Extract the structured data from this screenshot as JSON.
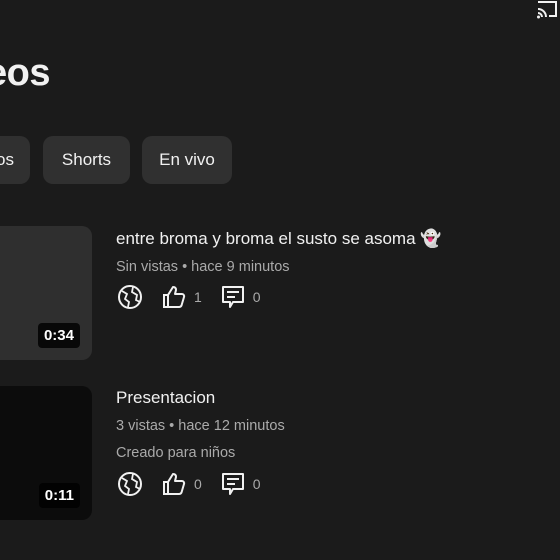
{
  "header": {
    "title": "eos",
    "cast_icon": "cast-icon"
  },
  "tabs": [
    {
      "label": "os"
    },
    {
      "label": "Shorts"
    },
    {
      "label": "En vivo"
    }
  ],
  "videos": [
    {
      "title": "entre broma y broma el susto se asoma 👻",
      "meta": "Sin vistas • hace 9 minutos",
      "made_for_kids": "",
      "duration": "0:34",
      "visibility_icon": "globe-icon",
      "likes": "1",
      "comments": "0"
    },
    {
      "title": "Presentacion",
      "meta": "3 vistas • hace 12 minutos",
      "made_for_kids": "Creado para niños",
      "duration": "0:11",
      "visibility_icon": "globe-icon",
      "likes": "0",
      "comments": "0"
    }
  ],
  "colors": {
    "background": "#1b1b1b",
    "chip": "#303030",
    "secondary_text": "#aaaaaa"
  }
}
